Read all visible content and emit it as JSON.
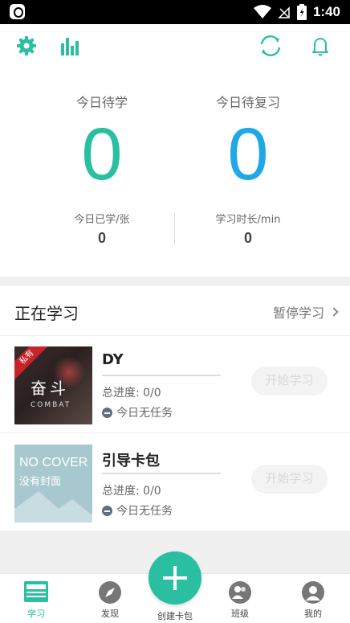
{
  "status_bar": {
    "time": "1:40"
  },
  "colors": {
    "accent": "#29bfa0",
    "blue": "#1fa8e8"
  },
  "toolbar": {
    "left_icons": [
      "gear-icon",
      "bar-chart-icon"
    ],
    "right_icons": [
      "sync-icon",
      "bell-icon"
    ]
  },
  "stats": {
    "todo_label": "今日待学",
    "todo_value": "0",
    "review_label": "今日待复习",
    "review_value": "0",
    "learned_label": "今日已学/张",
    "learned_value": "0",
    "duration_label": "学习时长/min",
    "duration_value": "0"
  },
  "learning": {
    "title": "正在学习",
    "pause_label": "暂停学习",
    "cards": [
      {
        "title": "DY",
        "progress": "总进度: 0/0",
        "task": "今日无任务",
        "start_label": "开始学习",
        "cover": {
          "stamp": "私有",
          "text": "奋斗",
          "sub": "COMBAT"
        }
      },
      {
        "title": "引导卡包",
        "progress": "总进度: 0/0",
        "task": "今日无任务",
        "start_label": "开始学习",
        "cover": {
          "text": "NO COVER",
          "sub": "没有封面"
        }
      }
    ]
  },
  "bottom_nav": {
    "items": [
      {
        "label": "学习",
        "icon": "study-icon"
      },
      {
        "label": "发现",
        "icon": "compass-icon"
      },
      {
        "label": "创建卡包",
        "icon": "plus-icon"
      },
      {
        "label": "班级",
        "icon": "class-icon"
      },
      {
        "label": "我的",
        "icon": "profile-icon"
      }
    ]
  }
}
